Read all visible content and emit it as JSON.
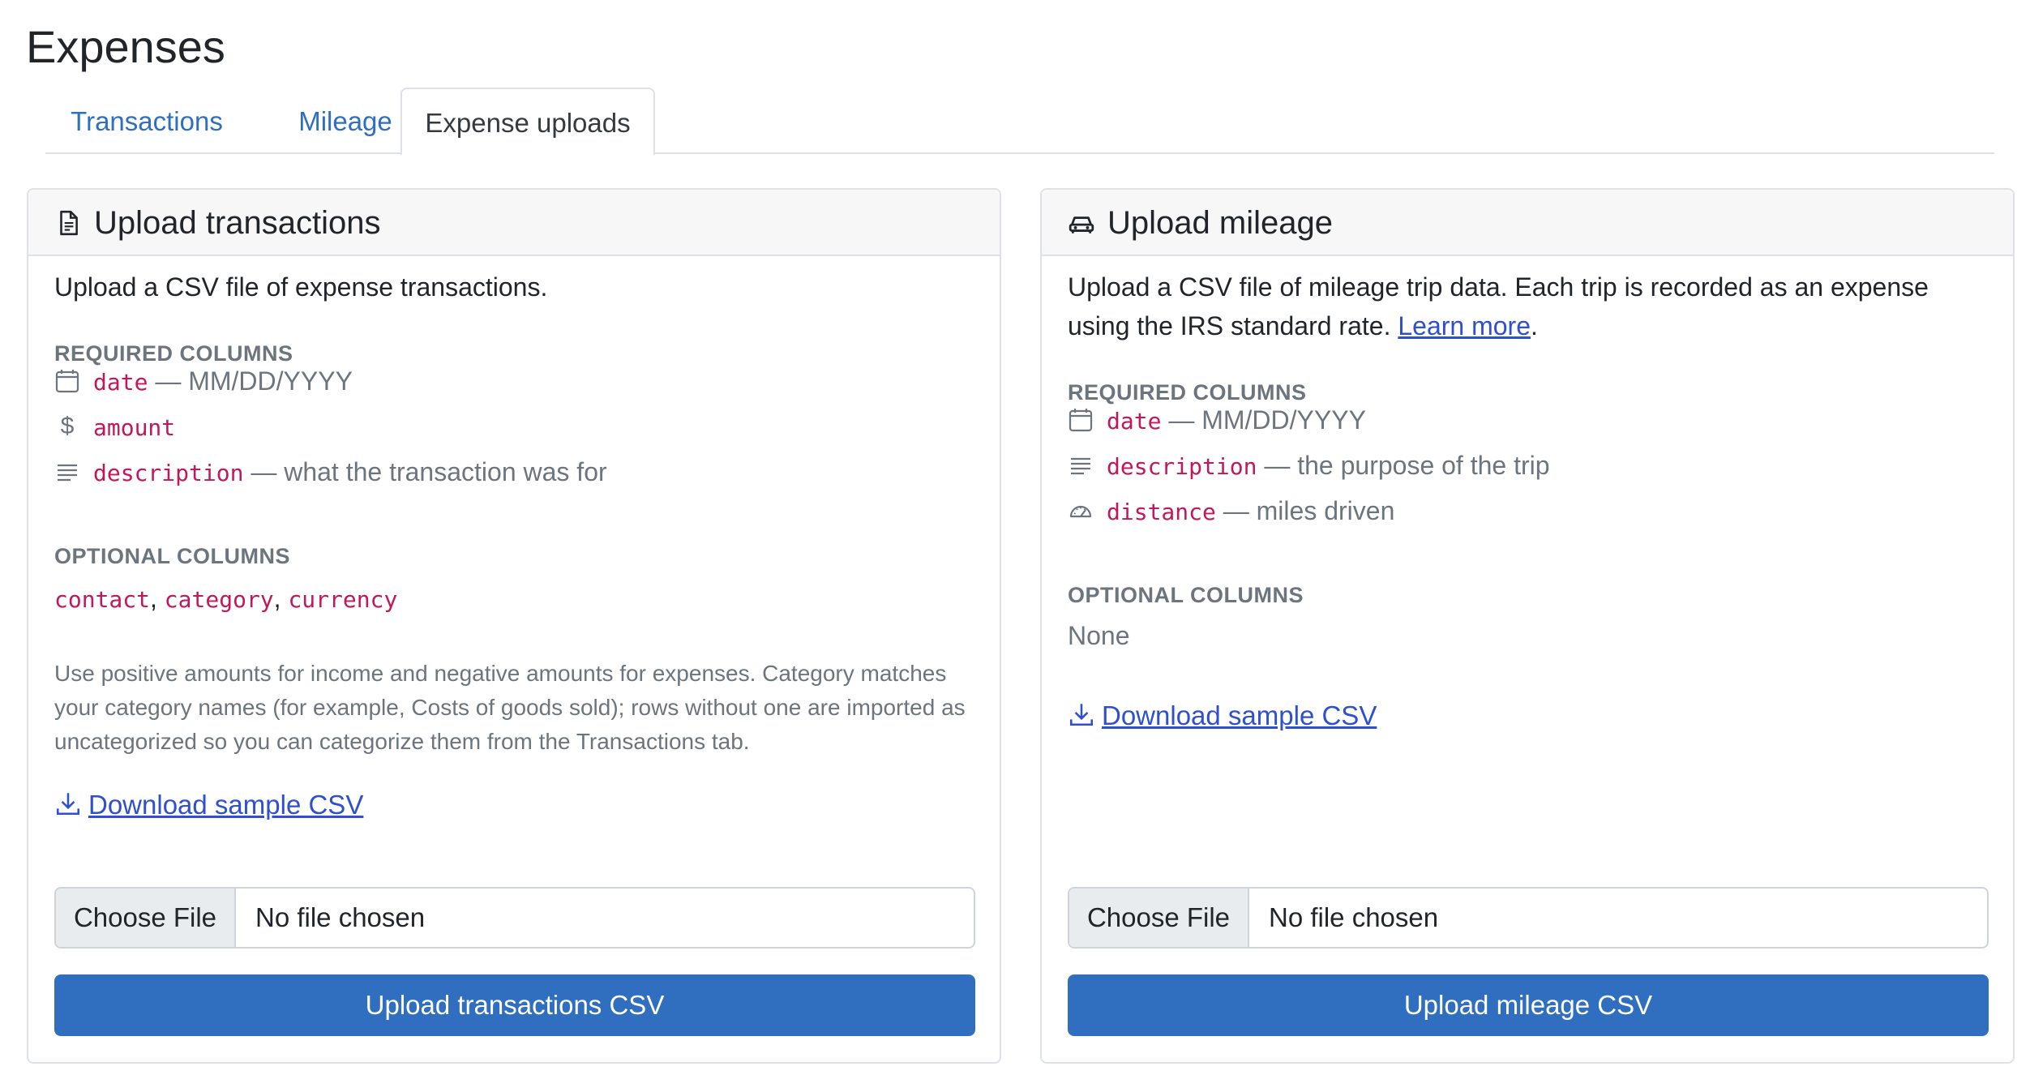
{
  "page": {
    "title": "Expenses"
  },
  "tabs": [
    "Transactions",
    "Mileage",
    "Expense uploads"
  ],
  "active_tab": "Expense uploads",
  "transactions": {
    "title": "Upload transactions",
    "icon": "document-icon",
    "intro": "Upload a CSV file of expense transactions.",
    "required_label": "REQUIRED COLUMNS",
    "required": [
      {
        "icon": "calendar-icon",
        "name": "date",
        "desc": "— MM/DD/YYYY"
      },
      {
        "icon": "dollar-icon",
        "name": "amount",
        "desc": ""
      },
      {
        "icon": "text-lines-icon",
        "name": "description",
        "desc": "— what the transaction was for"
      }
    ],
    "optional_label": "OPTIONAL COLUMNS",
    "optional": [
      "contact",
      "category",
      "currency"
    ],
    "note": "Use positive amounts for income and negative amounts for expenses. Category matches your category names (for example, Costs of goods sold); rows without one are imported as uncategorized so you can categorize them from the Transactions tab.",
    "download": "Download sample CSV",
    "file_button": "Choose File",
    "file_status": "No file chosen",
    "submit": "Upload transactions CSV"
  },
  "mileage": {
    "title": "Upload mileage",
    "icon": "car-icon",
    "intro": "Upload a CSV file of mileage trip data. Each trip is recorded as an expense using the IRS standard rate.",
    "learn_more": "Learn more",
    "required_label": "REQUIRED COLUMNS",
    "required": [
      {
        "icon": "calendar-icon",
        "name": "date",
        "desc": "— MM/DD/YYYY"
      },
      {
        "icon": "text-lines-icon",
        "name": "description",
        "desc": "— the purpose of the trip"
      },
      {
        "icon": "speedometer-icon",
        "name": "distance",
        "desc": "— miles driven"
      }
    ],
    "optional_label": "OPTIONAL COLUMNS",
    "optional_none": "None",
    "download": "Download sample CSV",
    "file_button": "Choose File",
    "file_status": "No file chosen",
    "submit": "Upload mileage CSV"
  },
  "colors": {
    "link": "#2f6fbf",
    "primary": "#306fbf",
    "code": "#c2185b",
    "muted": "#6c757d"
  }
}
